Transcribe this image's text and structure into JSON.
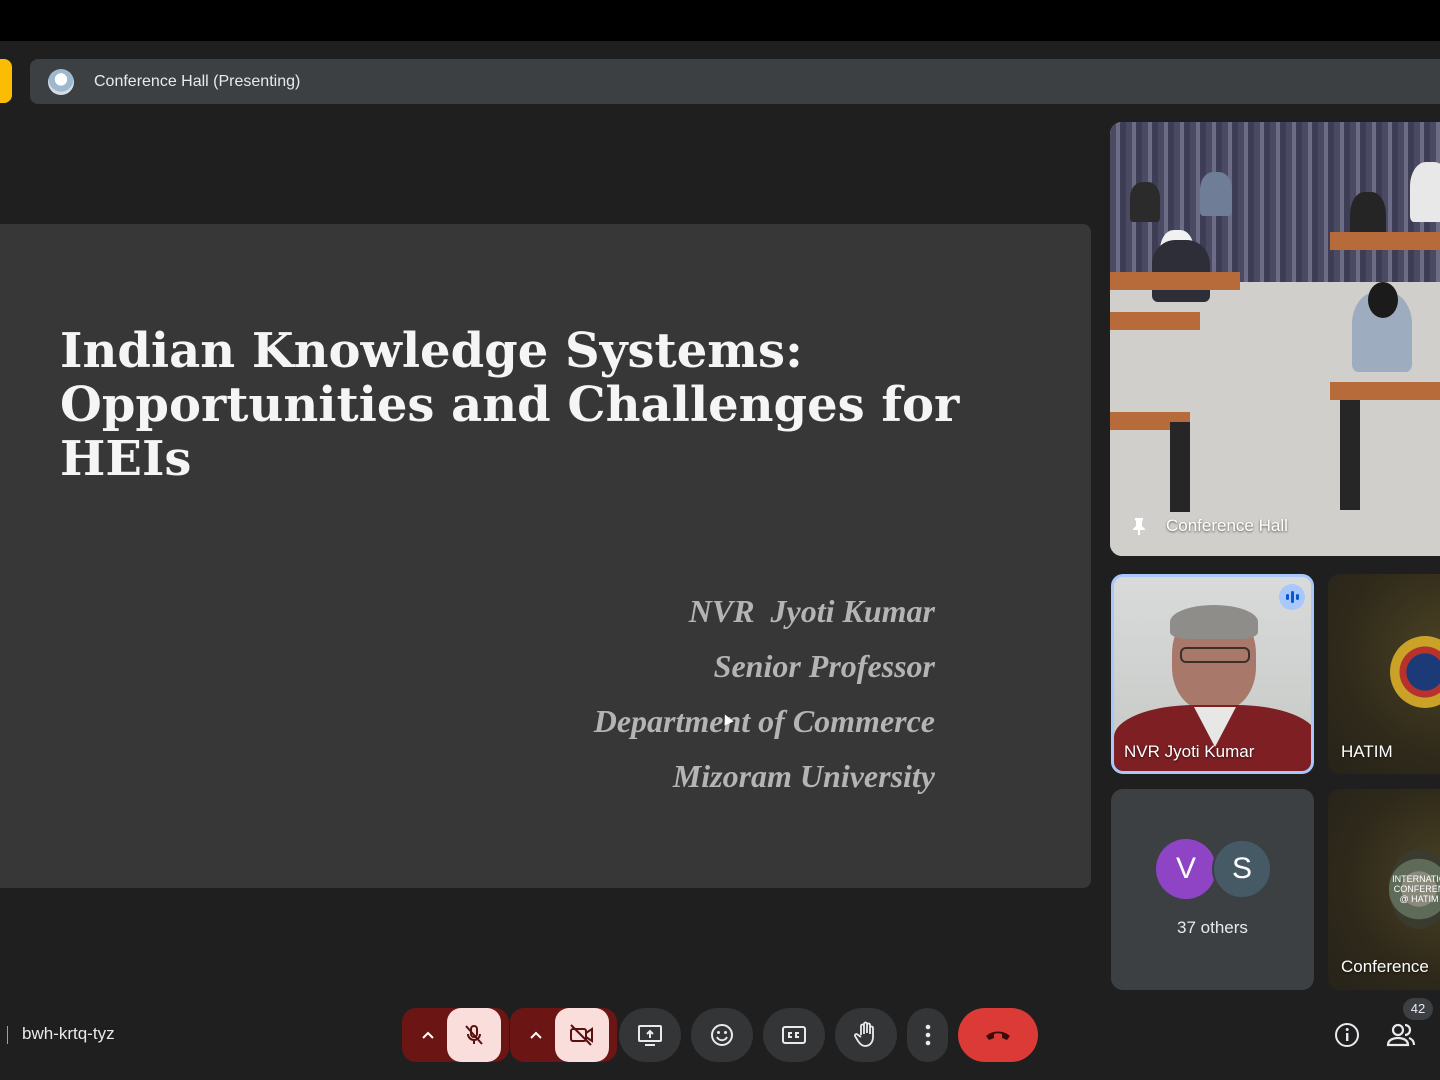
{
  "header": {
    "presenting_title": "Conference Hall (Presenting)"
  },
  "slide": {
    "title_lines": [
      "Indian Knowledge Systems:",
      "Opportunities and Challenges for",
      "HEIs"
    ],
    "author_lines": [
      "NVR  Jyoti Kumar",
      "Senior Professor",
      "Department of Commerce",
      "Mizoram University"
    ]
  },
  "participants": {
    "pinned_tile": {
      "name": "Conference Hall",
      "pinned": true
    },
    "speaker_tile": {
      "name": "NVR Jyoti Kumar",
      "speaking": true
    },
    "hatim_tile": {
      "name": "HATIM"
    },
    "others_tile": {
      "avatar_initials": [
        "V",
        "S"
      ],
      "label": "37 others"
    },
    "conference_tile": {
      "name": "Conference",
      "logo_text": [
        "INTERNATIO",
        "CONFEREN",
        "@ HATIM"
      ]
    }
  },
  "bottom_bar": {
    "meeting_code": "bwh-krtq-tyz",
    "people_count": "42"
  },
  "colors": {
    "accent_yellow": "#fbbc04",
    "end_call_red": "#dc3a36",
    "mic_off_bg": "#6b1515",
    "speaking_border": "#a8c7fa"
  }
}
